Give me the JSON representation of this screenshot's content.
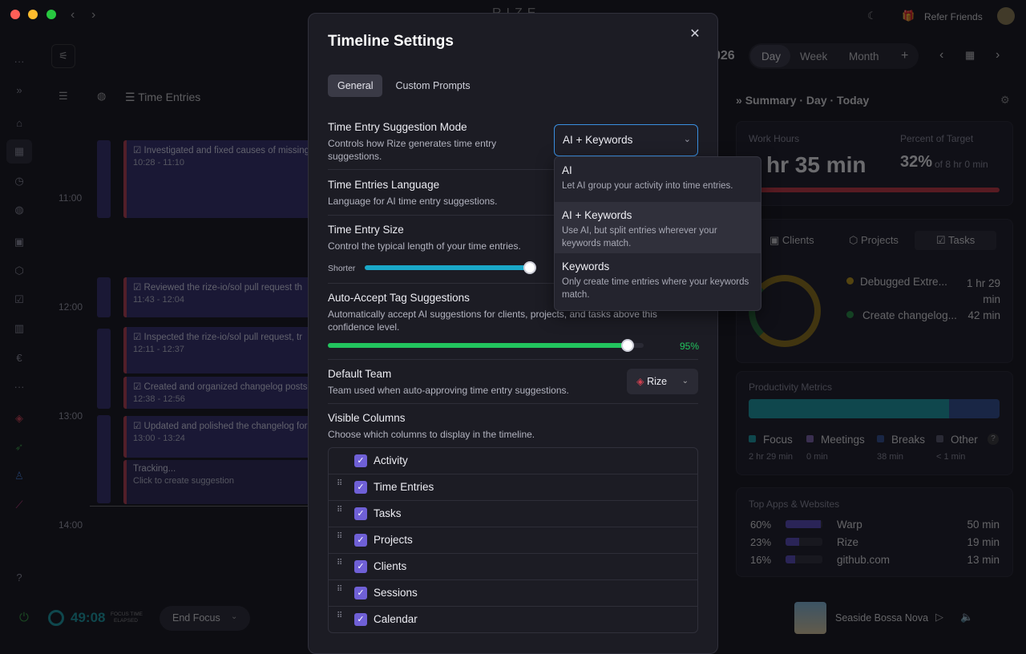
{
  "app": {
    "brand": "RIZE",
    "refer_friends": "Refer Friends"
  },
  "toolbar": {
    "year_fragment": "026",
    "view_tabs": [
      "Day",
      "Week",
      "Month"
    ],
    "add": "+"
  },
  "timeline": {
    "header_label": "Time Entries",
    "times": [
      "11:00",
      "12:00",
      "13:00",
      "14:00"
    ],
    "entries": [
      {
        "title": "Investigated and fixed causes of missing",
        "time": "10:28 - 11:10"
      },
      {
        "title": "Reviewed the rize-io/sol pull request th",
        "time": "11:43 - 12:04"
      },
      {
        "title": "Inspected the rize-io/sol pull request, tr",
        "time": "12:11 - 12:37"
      },
      {
        "title": "Created and organized changelog posts",
        "time": "12:38 - 12:56"
      },
      {
        "title": "Updated and polished the changelog for",
        "time": "13:00 - 13:24"
      },
      {
        "title": "Tracking...",
        "time": "Click to create suggestion"
      }
    ]
  },
  "summary": {
    "title": "Summary · Day · Today",
    "work_hours_label": "Work Hours",
    "work_hours_value": "hr 35 min",
    "percent_label": "Percent of Target",
    "percent_value": "32%",
    "percent_of": "of 8 hr 0 min",
    "percent_fraction": 0.32,
    "tabs": [
      "Clients",
      "Projects",
      "Tasks"
    ],
    "tasks": [
      {
        "name": "Debugged Extre...",
        "duration": "1 hr 29 min",
        "color": "#b8920f"
      },
      {
        "name": "Create changelog...",
        "duration": "42 min",
        "color": "#1f8a3c"
      }
    ],
    "productivity_label": "Productivity Metrics",
    "productivity_focus_fraction": 0.8,
    "metrics": [
      {
        "name": "Focus",
        "value": "2 hr 29 min",
        "color": "#139aa0"
      },
      {
        "name": "Meetings",
        "value": "0 min",
        "color": "#7a5fa8"
      },
      {
        "name": "Breaks",
        "value": "38 min",
        "color": "#2d4a8c"
      },
      {
        "name": "Other",
        "value": "< 1 min",
        "color": "#555566"
      }
    ],
    "other_help": "?",
    "top_apps_label": "Top Apps & Websites",
    "apps": [
      {
        "pct": "60%",
        "name": "Warp",
        "duration": "50 min",
        "fraction": 0.6
      },
      {
        "pct": "23%",
        "name": "Rize",
        "duration": "19 min",
        "fraction": 0.23
      },
      {
        "pct": "16%",
        "name": "github.com",
        "duration": "13 min",
        "fraction": 0.16
      }
    ]
  },
  "footer": {
    "timer": "49:08",
    "focus_caption_1": "FOCUS TIME",
    "focus_caption_2": "ELAPSED",
    "end_focus": "End Focus",
    "track": "Seaside Bossa Nova"
  },
  "modal": {
    "title": "Timeline Settings",
    "tabs": [
      "General",
      "Custom Prompts"
    ],
    "suggestion_mode": {
      "title": "Time Entry Suggestion Mode",
      "desc": "Controls how Rize generates time entry suggestions.",
      "value": "AI + Keywords"
    },
    "language": {
      "title": "Time Entries Language",
      "desc": "Language for AI time entry suggestions."
    },
    "size": {
      "title": "Time Entry Size",
      "desc": "Control the typical length of your time entries.",
      "min_label": "Shorter",
      "level": 1.0
    },
    "auto_accept": {
      "title": "Auto-Accept Tag Suggestions",
      "desc": "Automatically accept AI suggestions for clients, projects, and tasks above this confidence level.",
      "value": "95%",
      "level": 0.95
    },
    "default_team": {
      "title": "Default Team",
      "desc": "Team used when auto-approving time entry suggestions.",
      "value": "Rize"
    },
    "visible_columns": {
      "title": "Visible Columns",
      "desc": "Choose which columns to display in the timeline.",
      "items": [
        "Activity",
        "Time Entries",
        "Tasks",
        "Projects",
        "Clients",
        "Sessions",
        "Calendar"
      ]
    }
  },
  "dropdown": {
    "options": [
      {
        "name": "AI",
        "desc": "Let AI group your activity into time entries."
      },
      {
        "name": "AI + Keywords",
        "desc": "Use AI, but split entries wherever your keywords match."
      },
      {
        "name": "Keywords",
        "desc": "Only create time entries where your keywords match."
      }
    ]
  }
}
